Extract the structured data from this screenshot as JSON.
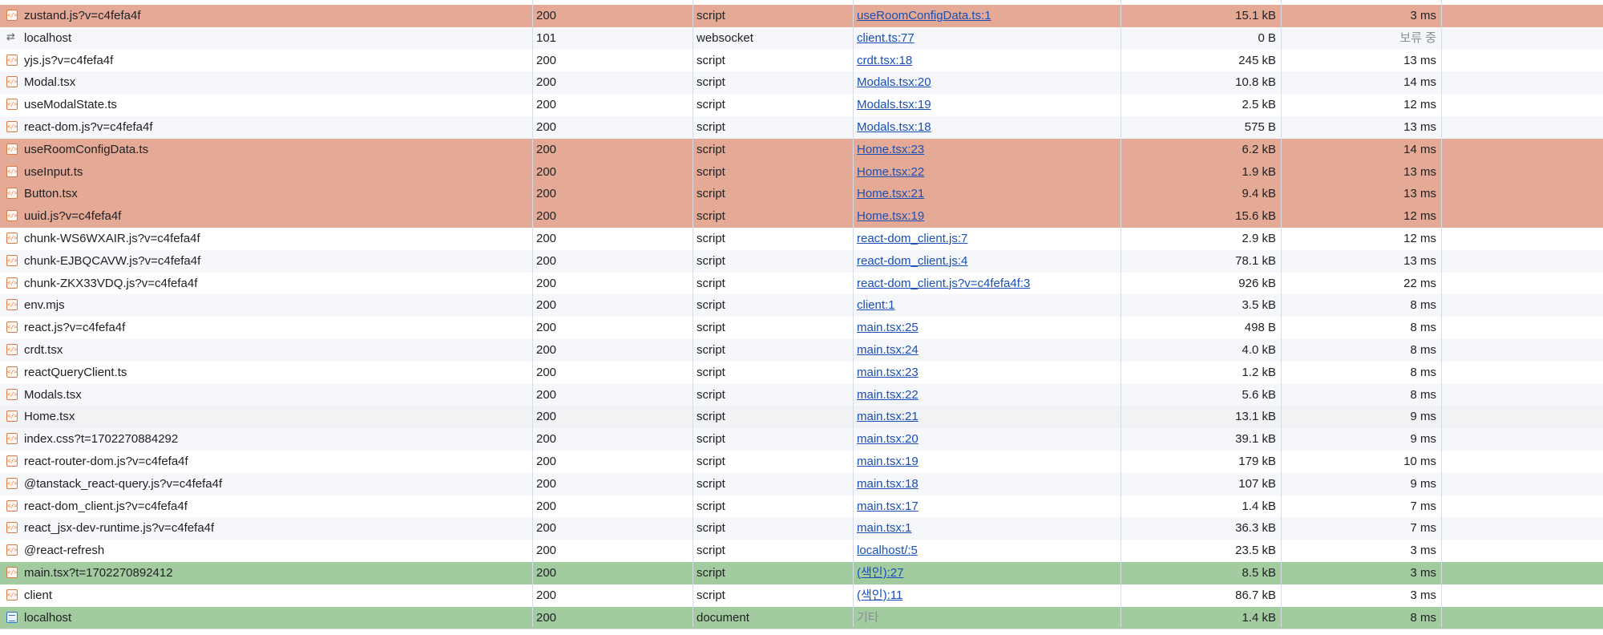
{
  "colors": {
    "highlight_red": "#e5aa96",
    "highlight_green": "#a3cba0",
    "link": "#1a4fb5"
  },
  "requests": [
    {
      "name": "zustand.js?v=c4fefa4f",
      "status": "200",
      "type": "script",
      "initiator": "useRoomConfigData.ts:1",
      "size": "15.1 kB",
      "time": "3 ms",
      "icon": "script-icon",
      "highlight": "red"
    },
    {
      "name": "localhost",
      "status": "101",
      "type": "websocket",
      "initiator": "client.ts:77",
      "size": "0 B",
      "time": "보류 중",
      "icon": "websocket-icon",
      "highlight": ""
    },
    {
      "name": "yjs.js?v=c4fefa4f",
      "status": "200",
      "type": "script",
      "initiator": "crdt.tsx:18",
      "size": "245 kB",
      "time": "13 ms",
      "icon": "script-icon",
      "highlight": ""
    },
    {
      "name": "Modal.tsx",
      "status": "200",
      "type": "script",
      "initiator": "Modals.tsx:20",
      "size": "10.8 kB",
      "time": "14 ms",
      "icon": "script-icon",
      "highlight": ""
    },
    {
      "name": "useModalState.ts",
      "status": "200",
      "type": "script",
      "initiator": "Modals.tsx:19",
      "size": "2.5 kB",
      "time": "12 ms",
      "icon": "script-icon",
      "highlight": ""
    },
    {
      "name": "react-dom.js?v=c4fefa4f",
      "status": "200",
      "type": "script",
      "initiator": "Modals.tsx:18",
      "size": "575 B",
      "time": "13 ms",
      "icon": "script-icon",
      "highlight": ""
    },
    {
      "name": "useRoomConfigData.ts",
      "status": "200",
      "type": "script",
      "initiator": "Home.tsx:23",
      "size": "6.2 kB",
      "time": "14 ms",
      "icon": "script-icon",
      "highlight": "red"
    },
    {
      "name": "useInput.ts",
      "status": "200",
      "type": "script",
      "initiator": "Home.tsx:22",
      "size": "1.9 kB",
      "time": "13 ms",
      "icon": "script-icon",
      "highlight": "red"
    },
    {
      "name": "Button.tsx",
      "status": "200",
      "type": "script",
      "initiator": "Home.tsx:21",
      "size": "9.4 kB",
      "time": "13 ms",
      "icon": "script-icon",
      "highlight": "red"
    },
    {
      "name": "uuid.js?v=c4fefa4f",
      "status": "200",
      "type": "script",
      "initiator": "Home.tsx:19",
      "size": "15.6 kB",
      "time": "12 ms",
      "icon": "script-icon",
      "highlight": "red"
    },
    {
      "name": "chunk-WS6WXAIR.js?v=c4fefa4f",
      "status": "200",
      "type": "script",
      "initiator": "react-dom_client.js:7",
      "size": "2.9 kB",
      "time": "12 ms",
      "icon": "script-icon",
      "highlight": ""
    },
    {
      "name": "chunk-EJBQCAVW.js?v=c4fefa4f",
      "status": "200",
      "type": "script",
      "initiator": "react-dom_client.js:4",
      "size": "78.1 kB",
      "time": "13 ms",
      "icon": "script-icon",
      "highlight": ""
    },
    {
      "name": "chunk-ZKX33VDQ.js?v=c4fefa4f",
      "status": "200",
      "type": "script",
      "initiator": "react-dom_client.js?v=c4fefa4f:3",
      "size": "926 kB",
      "time": "22 ms",
      "icon": "script-icon",
      "highlight": ""
    },
    {
      "name": "env.mjs",
      "status": "200",
      "type": "script",
      "initiator": "client:1",
      "size": "3.5 kB",
      "time": "8 ms",
      "icon": "script-icon",
      "highlight": ""
    },
    {
      "name": "react.js?v=c4fefa4f",
      "status": "200",
      "type": "script",
      "initiator": "main.tsx:25",
      "size": "498 B",
      "time": "8 ms",
      "icon": "script-icon",
      "highlight": ""
    },
    {
      "name": "crdt.tsx",
      "status": "200",
      "type": "script",
      "initiator": "main.tsx:24",
      "size": "4.0 kB",
      "time": "8 ms",
      "icon": "script-icon",
      "highlight": ""
    },
    {
      "name": "reactQueryClient.ts",
      "status": "200",
      "type": "script",
      "initiator": "main.tsx:23",
      "size": "1.2 kB",
      "time": "8 ms",
      "icon": "script-icon",
      "highlight": ""
    },
    {
      "name": "Modals.tsx",
      "status": "200",
      "type": "script",
      "initiator": "main.tsx:22",
      "size": "5.6 kB",
      "time": "8 ms",
      "icon": "script-icon",
      "highlight": ""
    },
    {
      "name": "Home.tsx",
      "status": "200",
      "type": "script",
      "initiator": "main.tsx:21",
      "size": "13.1 kB",
      "time": "9 ms",
      "icon": "script-icon",
      "highlight": "hover"
    },
    {
      "name": "index.css?t=1702270884292",
      "status": "200",
      "type": "script",
      "initiator": "main.tsx:20",
      "size": "39.1 kB",
      "time": "9 ms",
      "icon": "script-icon",
      "highlight": ""
    },
    {
      "name": "react-router-dom.js?v=c4fefa4f",
      "status": "200",
      "type": "script",
      "initiator": "main.tsx:19",
      "size": "179 kB",
      "time": "10 ms",
      "icon": "script-icon",
      "highlight": ""
    },
    {
      "name": "@tanstack_react-query.js?v=c4fefa4f",
      "status": "200",
      "type": "script",
      "initiator": "main.tsx:18",
      "size": "107 kB",
      "time": "9 ms",
      "icon": "script-icon",
      "highlight": ""
    },
    {
      "name": "react-dom_client.js?v=c4fefa4f",
      "status": "200",
      "type": "script",
      "initiator": "main.tsx:17",
      "size": "1.4 kB",
      "time": "7 ms",
      "icon": "script-icon",
      "highlight": ""
    },
    {
      "name": "react_jsx-dev-runtime.js?v=c4fefa4f",
      "status": "200",
      "type": "script",
      "initiator": "main.tsx:1",
      "size": "36.3 kB",
      "time": "7 ms",
      "icon": "script-icon",
      "highlight": ""
    },
    {
      "name": "@react-refresh",
      "status": "200",
      "type": "script",
      "initiator": "localhost/:5",
      "size": "23.5 kB",
      "time": "3 ms",
      "icon": "script-icon",
      "highlight": ""
    },
    {
      "name": "main.tsx?t=1702270892412",
      "status": "200",
      "type": "script",
      "initiator": "(색인):27",
      "size": "8.5 kB",
      "time": "3 ms",
      "icon": "script-icon",
      "highlight": "green"
    },
    {
      "name": "client",
      "status": "200",
      "type": "script",
      "initiator": "(색인):11",
      "size": "86.7 kB",
      "time": "3 ms",
      "icon": "script-icon",
      "highlight": ""
    },
    {
      "name": "localhost",
      "status": "200",
      "type": "document",
      "initiator": "기타",
      "size": "1.4 kB",
      "time": "8 ms",
      "icon": "document-icon",
      "highlight": "green",
      "initiator_plain": true
    }
  ]
}
